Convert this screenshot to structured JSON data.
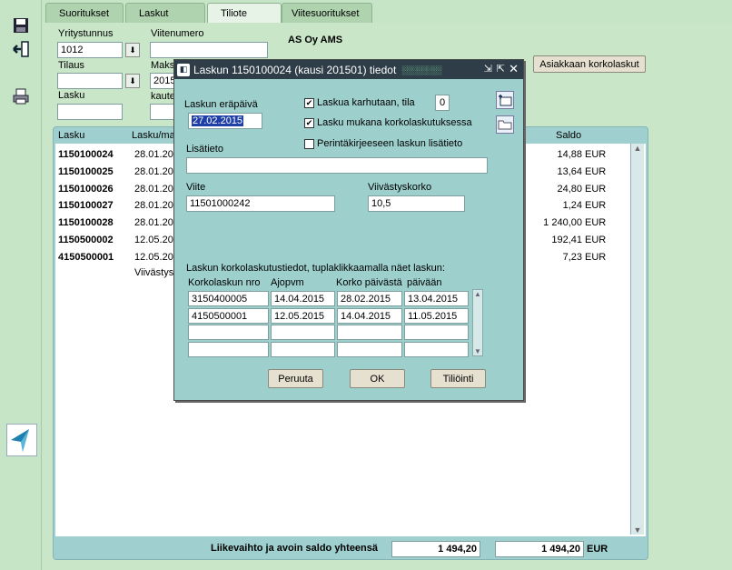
{
  "tabs": [
    {
      "label": "Suoritukset"
    },
    {
      "label": "Laskut"
    },
    {
      "label": "Tiliote"
    },
    {
      "label": "Viitesuoritukset"
    }
  ],
  "form": {
    "yritystunnus_label": "Yritystunnus",
    "yritystunnus_value": "1012",
    "viitenumero_label": "Viitenumero",
    "viitenumero_value": "",
    "company_name": "AS Oy AMS",
    "tilaus_label": "Tilaus",
    "tilaus_value": "",
    "maks_label": "Maks",
    "maks_value": "2015",
    "lasku_label": "Lasku",
    "lasku_value": "",
    "kaute_label": "kaute",
    "asiakkaan_button": "Asiakkaan korkolaskut"
  },
  "table": {
    "headers": {
      "lasku": "Lasku",
      "laskuma": "Lasku/ma",
      "saldo": "Saldo"
    },
    "rows": [
      {
        "lasku": "1150100024",
        "date": "28.01.20",
        "saldo": "14,88",
        "cur": "EUR"
      },
      {
        "lasku": "1150100025",
        "date": "28.01.20",
        "saldo": "13,64",
        "cur": "EUR"
      },
      {
        "lasku": "1150100026",
        "date": "28.01.20",
        "saldo": "24,80",
        "cur": "EUR"
      },
      {
        "lasku": "1150100027",
        "date": "28.01.20",
        "saldo": "1,24",
        "cur": "EUR"
      },
      {
        "lasku": "1150100028",
        "date": "28.01.20",
        "saldo": "1 240,00",
        "cur": "EUR"
      },
      {
        "lasku": "1150500002",
        "date": "12.05.20",
        "saldo": "192,41",
        "cur": "EUR"
      },
      {
        "lasku": "4150500001",
        "date": "12.05.20",
        "saldo": "7,23",
        "cur": "EUR"
      }
    ],
    "extra_row_text": "Viivästys",
    "footer_label": "Liikevaihto ja avoin saldo yhteensä",
    "footer_total1": "1 494,20",
    "footer_total2": "1 494,20",
    "footer_currency": "EUR"
  },
  "dialog": {
    "title": "Laskun 1150100024 (kausi 201501) tiedot",
    "erapaiva_label": "Laskun eräpäivä",
    "erapaiva_value": "27.02.2015",
    "karhutaan_label": "Laskua karhutaan, tila",
    "karhutaan_checked": true,
    "tila_value": "0",
    "korkolaskutus_label": "Lasku mukana korkolaskutuksessa",
    "korkolaskutus_checked": true,
    "perinta_label": "Perintäkirjeeseen laskun lisätieto",
    "perinta_checked": false,
    "lisatieto_label": "Lisätieto",
    "lisatieto_value": "",
    "viite_label": "Viite",
    "viite_value": "11501000242",
    "viivastyskorko_label": "Viivästyskorko",
    "viivastyskorko_value": "10,5",
    "korkolasku_info": "Laskun korkolaskutustiedot, tuplaklikkaamalla näet laskun:",
    "grid_headers": [
      "Korkolaskun nro",
      "Ajopvm",
      "Korko päivästä",
      "päivään"
    ],
    "grid_rows": [
      [
        "3150400005",
        "14.04.2015",
        "28.02.2015",
        "13.04.2015"
      ],
      [
        "4150500001",
        "12.05.2015",
        "14.04.2015",
        "11.05.2015"
      ],
      [
        "",
        "",
        "",
        ""
      ],
      [
        "",
        "",
        "",
        ""
      ]
    ],
    "buttons": {
      "cancel": "Peruuta",
      "ok": "OK",
      "tilointi": "Tiliöinti"
    }
  }
}
